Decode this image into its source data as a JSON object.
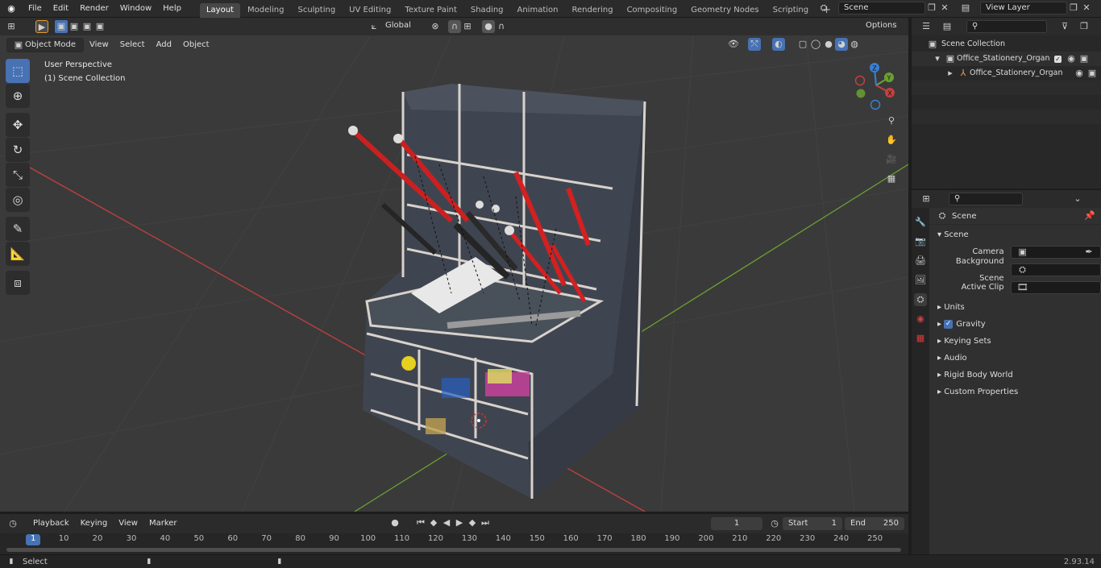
{
  "menus": [
    "File",
    "Edit",
    "Render",
    "Window",
    "Help"
  ],
  "workspace_tabs": [
    "Layout",
    "Modeling",
    "Sculpting",
    "UV Editing",
    "Texture Paint",
    "Shading",
    "Animation",
    "Rendering",
    "Compositing",
    "Geometry Nodes",
    "Scripting"
  ],
  "scene_field": "Scene",
  "view_layer_field": "View Layer",
  "viewport": {
    "mode": "Object Mode",
    "menu": [
      "View",
      "Select",
      "Add",
      "Object"
    ],
    "transform": "Global",
    "options": "Options",
    "overlay_title": "User Perspective",
    "overlay_subtitle": "(1) Scene Collection",
    "gizmo": {
      "x": "X",
      "y": "Y",
      "z": "Z"
    }
  },
  "outliner": {
    "root": "Scene Collection",
    "items": [
      "Office_Stationery_Organizer_",
      "Office_Stationery_Organ"
    ]
  },
  "properties": {
    "breadcrumb": "Scene",
    "panel": "Scene",
    "fields": [
      {
        "label": "Camera",
        "value": ""
      },
      {
        "label": "Background Scene",
        "value": ""
      },
      {
        "label": "Active Clip",
        "value": ""
      }
    ],
    "sections": [
      "Units",
      "Gravity",
      "Keying Sets",
      "Audio",
      "Rigid Body World",
      "Custom Properties"
    ]
  },
  "timeline": {
    "menu": [
      "Playback",
      "Keying",
      "View",
      "Marker"
    ],
    "current_frame": "1",
    "start_label": "Start",
    "start_value": "1",
    "end_label": "End",
    "end_value": "250",
    "ticks": [
      "1",
      "10",
      "20",
      "30",
      "40",
      "50",
      "60",
      "70",
      "80",
      "90",
      "100",
      "110",
      "120",
      "130",
      "140",
      "150",
      "160",
      "170",
      "180",
      "190",
      "200",
      "210",
      "220",
      "230",
      "240",
      "250"
    ]
  },
  "status": {
    "left": "Select",
    "version": "2.93.14"
  },
  "colors": {
    "accent": "#4772b3",
    "x_axis": "#c3413f",
    "y_axis": "#6aa131",
    "z_axis": "#3b7fd2"
  }
}
